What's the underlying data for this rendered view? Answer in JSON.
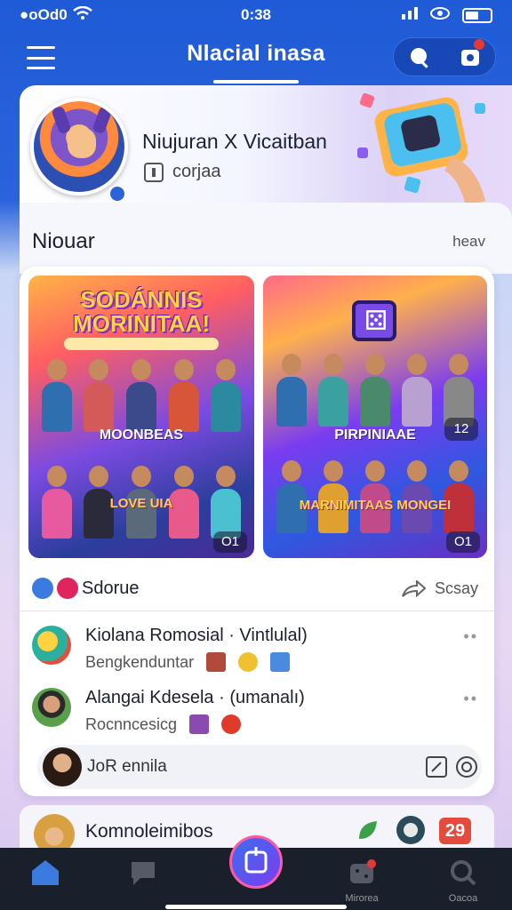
{
  "status_bar": {
    "carrier": "●oOd0",
    "time": "0:38",
    "battery": ""
  },
  "header": {
    "title": "Nlacial inasa"
  },
  "profile": {
    "name": "Niujuran X Vicaitban",
    "meta": "corjaa"
  },
  "section": {
    "title": "Niouar",
    "action": "heav"
  },
  "tiles": [
    {
      "headline": "SODÁNNIS MORINITAA!",
      "sub": "",
      "banner": "MOONBEAS",
      "banner2": "LOVE UIA",
      "count": "O1"
    },
    {
      "banner": "PIRPINIAAE",
      "banner2": "MARNIMITAAS MONGEI",
      "count_top": "12",
      "count": "O1"
    }
  ],
  "share_row": {
    "left_label": "Sdorue",
    "right_label": "Scsay"
  },
  "comments": [
    {
      "name": "Kiolana Romosial · Vintlulal)",
      "sub": "Bengkenduntar"
    },
    {
      "name": "Alangai Kdesela · (umanalı)",
      "sub": "Rocnncesicg"
    }
  ],
  "reply": {
    "placeholder": "JoR ennila"
  },
  "peek": {
    "name": "Komnoleimibos",
    "badge": "29"
  },
  "nav": {
    "items": [
      {
        "label": "",
        "icon": "home-icon"
      },
      {
        "label": "",
        "icon": "chat-icon"
      },
      {
        "label": "",
        "icon": "create-icon"
      },
      {
        "label": "Mirorea",
        "icon": "game-icon"
      },
      {
        "label": "Oacoa",
        "icon": "search-icon"
      }
    ]
  },
  "colors": {
    "primary": "#1f5bd6",
    "nav_bg": "#1a1f2c",
    "accent_pink": "#ff5aa6"
  }
}
